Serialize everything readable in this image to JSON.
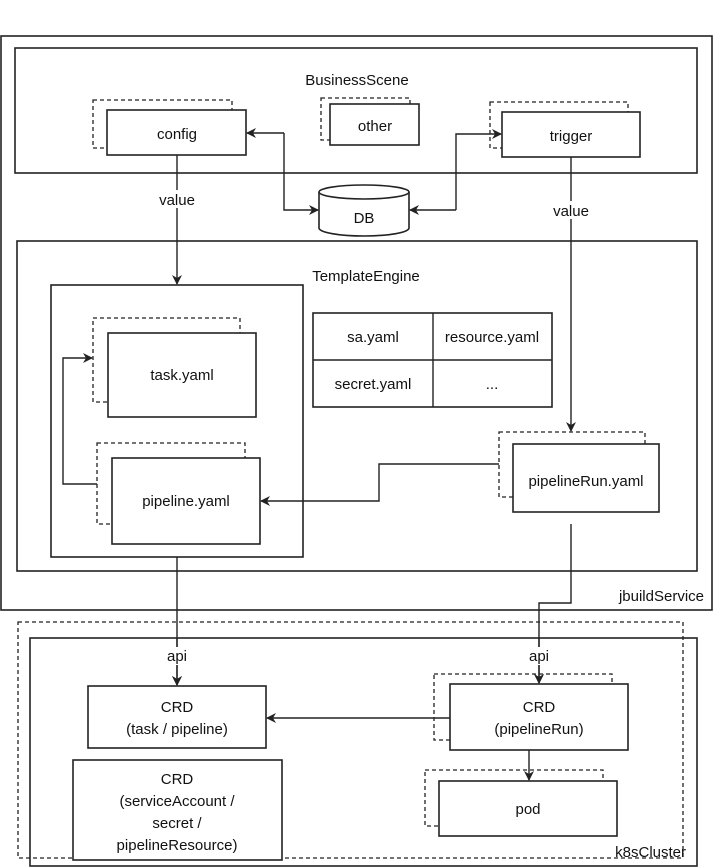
{
  "containers": {
    "jbuild_service": "jbuildService",
    "business_scene": "BusinessScene",
    "template_engine": "TemplateEngine",
    "k8s_cluster": "k8sCluster"
  },
  "nodes": {
    "config": "config",
    "other": "other",
    "trigger": "trigger",
    "db": "DB",
    "task_yaml": "task.yaml",
    "pipeline_yaml": "pipeline.yaml",
    "pipeline_run_yaml": "pipelineRun.yaml",
    "pod": "pod",
    "crd_task_pipeline": [
      "CRD",
      "(task / pipeline)"
    ],
    "crd_pipeline_run": [
      "CRD",
      "(pipelineRun)"
    ],
    "crd_service_account": [
      "CRD",
      "(serviceAccount /",
      "secret /",
      "pipelineResource)"
    ]
  },
  "table": [
    [
      "sa.yaml",
      "resource.yaml"
    ],
    [
      "secret.yaml",
      "..."
    ]
  ],
  "edge_labels": {
    "config_value": "value",
    "trigger_value": "value",
    "api_left": "api",
    "api_right": "api"
  }
}
